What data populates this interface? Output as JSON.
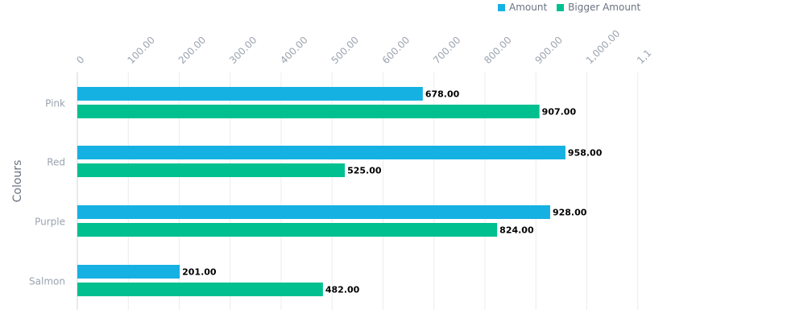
{
  "chart_data": {
    "type": "bar",
    "orientation": "horizontal",
    "categories": [
      "Pink",
      "Red",
      "Purple",
      "Salmon"
    ],
    "series": [
      {
        "name": "Amount",
        "color": "#16b1e3",
        "values": [
          678,
          958,
          928,
          201
        ],
        "labels": [
          "678.00",
          "958.00",
          "928.00",
          "201.00"
        ]
      },
      {
        "name": "Bigger Amount",
        "color": "#00c090",
        "values": [
          907,
          525,
          824,
          482
        ],
        "labels": [
          "907.00",
          "525.00",
          "824.00",
          "482.00"
        ]
      }
    ],
    "xticks": [
      {
        "value": 0,
        "label": "0"
      },
      {
        "value": 100,
        "label": "100.00"
      },
      {
        "value": 200,
        "label": "200.00"
      },
      {
        "value": 300,
        "label": "300.00"
      },
      {
        "value": 400,
        "label": "400.00"
      },
      {
        "value": 500,
        "label": "500.00"
      },
      {
        "value": 600,
        "label": "600.00"
      },
      {
        "value": 700,
        "label": "700.00"
      },
      {
        "value": 800,
        "label": "800.00"
      },
      {
        "value": 900,
        "label": "900.00"
      },
      {
        "value": 1000,
        "label": "1,000.00"
      },
      {
        "value": 1100,
        "label": "1,1"
      }
    ],
    "xlim": [
      0,
      1100
    ],
    "xaxis_position": "top",
    "xlabel": "",
    "ylabel": "Colours",
    "grid": true,
    "legend_position": "top-right"
  }
}
